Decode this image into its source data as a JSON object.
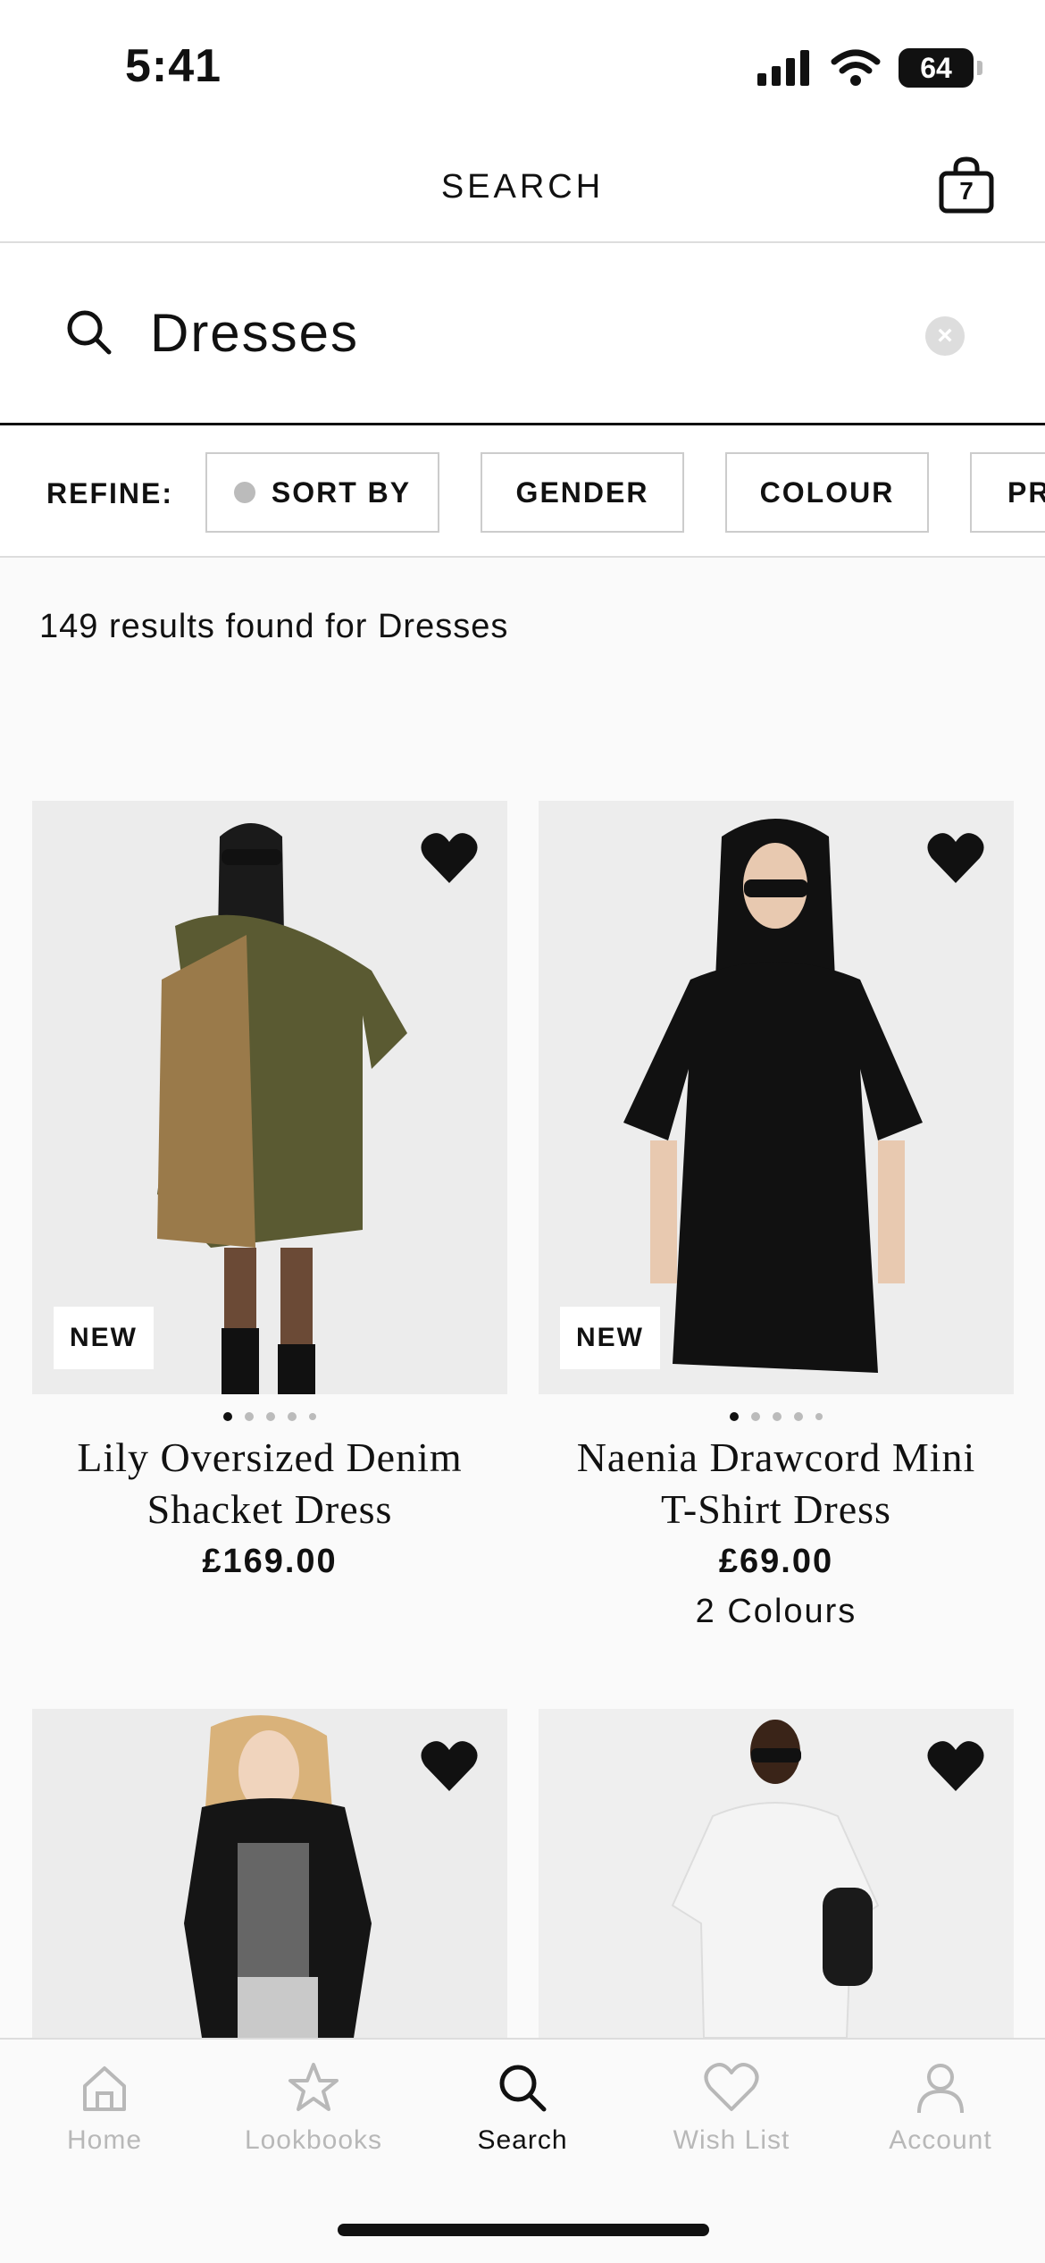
{
  "status_bar": {
    "time": "5:41",
    "battery": "64"
  },
  "header": {
    "title": "SEARCH",
    "bag_count": "7"
  },
  "search": {
    "value": "Dresses"
  },
  "refine": {
    "label": "REFINE:",
    "chips": [
      "SORT BY",
      "GENDER",
      "COLOUR",
      "PR"
    ]
  },
  "results_text": "149 results found for Dresses",
  "products": [
    {
      "badge": "NEW",
      "name_line1": "Lily Oversized Denim",
      "name_line2": "Shacket Dress",
      "price": "£169.00",
      "colours": ""
    },
    {
      "badge": "NEW",
      "name_line1": "Naenia Drawcord Mini",
      "name_line2": "T-Shirt Dress",
      "price": "£69.00",
      "colours": "2 Colours"
    }
  ],
  "tabs": [
    {
      "label": "Home",
      "icon": "home-icon"
    },
    {
      "label": "Lookbooks",
      "icon": "star-icon"
    },
    {
      "label": "Search",
      "icon": "search-icon"
    },
    {
      "label": "Wish List",
      "icon": "heart-icon"
    },
    {
      "label": "Account",
      "icon": "account-icon"
    }
  ],
  "active_tab": "Search",
  "colors": {
    "accent": "#111111",
    "inactive": "#b8b8b8",
    "image_bg": "#ececec"
  }
}
